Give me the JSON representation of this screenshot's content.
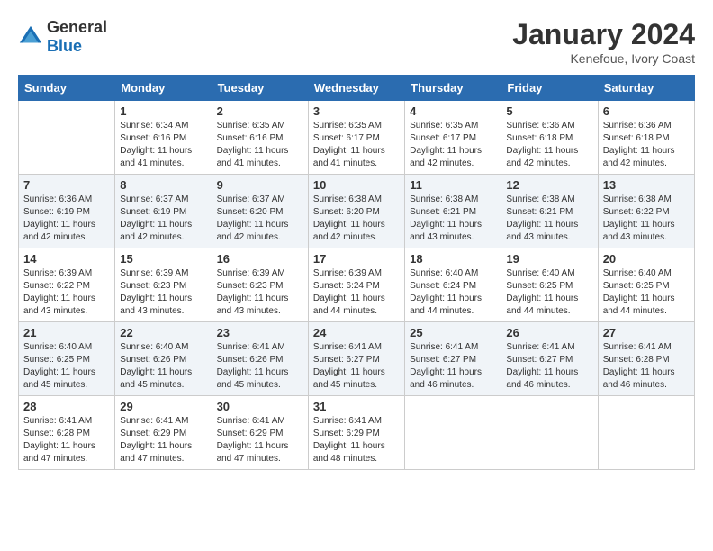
{
  "logo": {
    "general": "General",
    "blue": "Blue"
  },
  "title": "January 2024",
  "subtitle": "Kenefoue, Ivory Coast",
  "days_header": [
    "Sunday",
    "Monday",
    "Tuesday",
    "Wednesday",
    "Thursday",
    "Friday",
    "Saturday"
  ],
  "weeks": [
    [
      {
        "day": "",
        "sunrise": "",
        "sunset": "",
        "daylight": ""
      },
      {
        "day": "1",
        "sunrise": "Sunrise: 6:34 AM",
        "sunset": "Sunset: 6:16 PM",
        "daylight": "Daylight: 11 hours and 41 minutes."
      },
      {
        "day": "2",
        "sunrise": "Sunrise: 6:35 AM",
        "sunset": "Sunset: 6:16 PM",
        "daylight": "Daylight: 11 hours and 41 minutes."
      },
      {
        "day": "3",
        "sunrise": "Sunrise: 6:35 AM",
        "sunset": "Sunset: 6:17 PM",
        "daylight": "Daylight: 11 hours and 41 minutes."
      },
      {
        "day": "4",
        "sunrise": "Sunrise: 6:35 AM",
        "sunset": "Sunset: 6:17 PM",
        "daylight": "Daylight: 11 hours and 42 minutes."
      },
      {
        "day": "5",
        "sunrise": "Sunrise: 6:36 AM",
        "sunset": "Sunset: 6:18 PM",
        "daylight": "Daylight: 11 hours and 42 minutes."
      },
      {
        "day": "6",
        "sunrise": "Sunrise: 6:36 AM",
        "sunset": "Sunset: 6:18 PM",
        "daylight": "Daylight: 11 hours and 42 minutes."
      }
    ],
    [
      {
        "day": "7",
        "sunrise": "Sunrise: 6:36 AM",
        "sunset": "Sunset: 6:19 PM",
        "daylight": "Daylight: 11 hours and 42 minutes."
      },
      {
        "day": "8",
        "sunrise": "Sunrise: 6:37 AM",
        "sunset": "Sunset: 6:19 PM",
        "daylight": "Daylight: 11 hours and 42 minutes."
      },
      {
        "day": "9",
        "sunrise": "Sunrise: 6:37 AM",
        "sunset": "Sunset: 6:20 PM",
        "daylight": "Daylight: 11 hours and 42 minutes."
      },
      {
        "day": "10",
        "sunrise": "Sunrise: 6:38 AM",
        "sunset": "Sunset: 6:20 PM",
        "daylight": "Daylight: 11 hours and 42 minutes."
      },
      {
        "day": "11",
        "sunrise": "Sunrise: 6:38 AM",
        "sunset": "Sunset: 6:21 PM",
        "daylight": "Daylight: 11 hours and 43 minutes."
      },
      {
        "day": "12",
        "sunrise": "Sunrise: 6:38 AM",
        "sunset": "Sunset: 6:21 PM",
        "daylight": "Daylight: 11 hours and 43 minutes."
      },
      {
        "day": "13",
        "sunrise": "Sunrise: 6:38 AM",
        "sunset": "Sunset: 6:22 PM",
        "daylight": "Daylight: 11 hours and 43 minutes."
      }
    ],
    [
      {
        "day": "14",
        "sunrise": "Sunrise: 6:39 AM",
        "sunset": "Sunset: 6:22 PM",
        "daylight": "Daylight: 11 hours and 43 minutes."
      },
      {
        "day": "15",
        "sunrise": "Sunrise: 6:39 AM",
        "sunset": "Sunset: 6:23 PM",
        "daylight": "Daylight: 11 hours and 43 minutes."
      },
      {
        "day": "16",
        "sunrise": "Sunrise: 6:39 AM",
        "sunset": "Sunset: 6:23 PM",
        "daylight": "Daylight: 11 hours and 43 minutes."
      },
      {
        "day": "17",
        "sunrise": "Sunrise: 6:39 AM",
        "sunset": "Sunset: 6:24 PM",
        "daylight": "Daylight: 11 hours and 44 minutes."
      },
      {
        "day": "18",
        "sunrise": "Sunrise: 6:40 AM",
        "sunset": "Sunset: 6:24 PM",
        "daylight": "Daylight: 11 hours and 44 minutes."
      },
      {
        "day": "19",
        "sunrise": "Sunrise: 6:40 AM",
        "sunset": "Sunset: 6:25 PM",
        "daylight": "Daylight: 11 hours and 44 minutes."
      },
      {
        "day": "20",
        "sunrise": "Sunrise: 6:40 AM",
        "sunset": "Sunset: 6:25 PM",
        "daylight": "Daylight: 11 hours and 44 minutes."
      }
    ],
    [
      {
        "day": "21",
        "sunrise": "Sunrise: 6:40 AM",
        "sunset": "Sunset: 6:25 PM",
        "daylight": "Daylight: 11 hours and 45 minutes."
      },
      {
        "day": "22",
        "sunrise": "Sunrise: 6:40 AM",
        "sunset": "Sunset: 6:26 PM",
        "daylight": "Daylight: 11 hours and 45 minutes."
      },
      {
        "day": "23",
        "sunrise": "Sunrise: 6:41 AM",
        "sunset": "Sunset: 6:26 PM",
        "daylight": "Daylight: 11 hours and 45 minutes."
      },
      {
        "day": "24",
        "sunrise": "Sunrise: 6:41 AM",
        "sunset": "Sunset: 6:27 PM",
        "daylight": "Daylight: 11 hours and 45 minutes."
      },
      {
        "day": "25",
        "sunrise": "Sunrise: 6:41 AM",
        "sunset": "Sunset: 6:27 PM",
        "daylight": "Daylight: 11 hours and 46 minutes."
      },
      {
        "day": "26",
        "sunrise": "Sunrise: 6:41 AM",
        "sunset": "Sunset: 6:27 PM",
        "daylight": "Daylight: 11 hours and 46 minutes."
      },
      {
        "day": "27",
        "sunrise": "Sunrise: 6:41 AM",
        "sunset": "Sunset: 6:28 PM",
        "daylight": "Daylight: 11 hours and 46 minutes."
      }
    ],
    [
      {
        "day": "28",
        "sunrise": "Sunrise: 6:41 AM",
        "sunset": "Sunset: 6:28 PM",
        "daylight": "Daylight: 11 hours and 47 minutes."
      },
      {
        "day": "29",
        "sunrise": "Sunrise: 6:41 AM",
        "sunset": "Sunset: 6:29 PM",
        "daylight": "Daylight: 11 hours and 47 minutes."
      },
      {
        "day": "30",
        "sunrise": "Sunrise: 6:41 AM",
        "sunset": "Sunset: 6:29 PM",
        "daylight": "Daylight: 11 hours and 47 minutes."
      },
      {
        "day": "31",
        "sunrise": "Sunrise: 6:41 AM",
        "sunset": "Sunset: 6:29 PM",
        "daylight": "Daylight: 11 hours and 48 minutes."
      },
      {
        "day": "",
        "sunrise": "",
        "sunset": "",
        "daylight": ""
      },
      {
        "day": "",
        "sunrise": "",
        "sunset": "",
        "daylight": ""
      },
      {
        "day": "",
        "sunrise": "",
        "sunset": "",
        "daylight": ""
      }
    ]
  ]
}
